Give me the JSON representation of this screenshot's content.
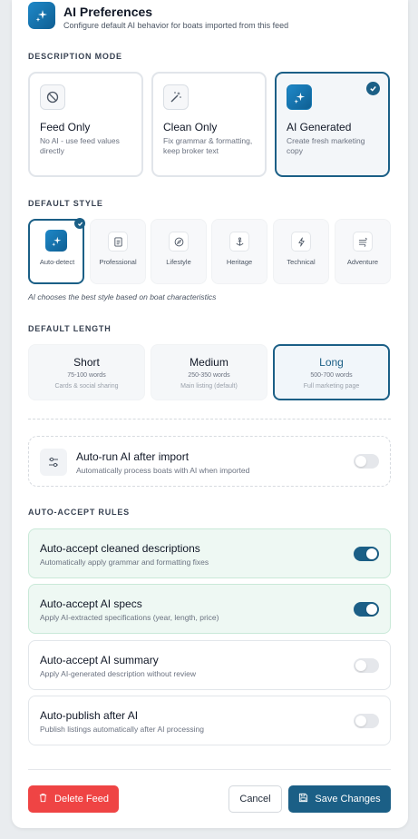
{
  "header": {
    "title": "AI Preferences",
    "subtitle": "Configure default AI behavior for boats imported from this feed",
    "icon": "sparkles-icon"
  },
  "description_mode": {
    "label": "DESCRIPTION MODE",
    "options": [
      {
        "title": "Feed Only",
        "desc": "No AI - use feed values directly",
        "icon": "ban-icon",
        "selected": false
      },
      {
        "title": "Clean Only",
        "desc": "Fix grammar & formatting, keep broker text",
        "icon": "magic-wand-icon",
        "selected": false
      },
      {
        "title": "AI Generated",
        "desc": "Create fresh marketing copy",
        "icon": "sparkles-icon",
        "selected": true
      }
    ]
  },
  "default_style": {
    "label": "DEFAULT STYLE",
    "options": [
      {
        "name": "Auto-detect",
        "icon": "sparkles-icon",
        "selected": true
      },
      {
        "name": "Professional",
        "icon": "document-icon",
        "selected": false
      },
      {
        "name": "Lifestyle",
        "icon": "compass-icon",
        "selected": false
      },
      {
        "name": "Heritage",
        "icon": "anchor-icon",
        "selected": false
      },
      {
        "name": "Technical",
        "icon": "lightning-icon",
        "selected": false
      },
      {
        "name": "Adventure",
        "icon": "wind-icon",
        "selected": false
      }
    ],
    "hint": "AI chooses the best style based on boat characteristics"
  },
  "default_length": {
    "label": "DEFAULT LENGTH",
    "options": [
      {
        "title": "Short",
        "words": "75-100 words",
        "desc": "Cards & social sharing",
        "selected": false
      },
      {
        "title": "Medium",
        "words": "250-350 words",
        "desc": "Main listing (default)",
        "selected": false
      },
      {
        "title": "Long",
        "words": "500-700 words",
        "desc": "Full marketing page",
        "selected": true
      }
    ]
  },
  "auto_run": {
    "title": "Auto-run AI after import",
    "desc": "Automatically process boats with AI when imported",
    "icon": "sliders-icon",
    "enabled": false
  },
  "auto_accept": {
    "label": "AUTO-ACCEPT RULES",
    "rules": [
      {
        "title": "Auto-accept cleaned descriptions",
        "desc": "Automatically apply grammar and formatting fixes",
        "enabled": true
      },
      {
        "title": "Auto-accept AI specs",
        "desc": "Apply AI-extracted specifications (year, length, price)",
        "enabled": true
      },
      {
        "title": "Auto-accept AI summary",
        "desc": "Apply AI-generated description without review",
        "enabled": false
      },
      {
        "title": "Auto-publish after AI",
        "desc": "Publish listings automatically after AI processing",
        "enabled": false
      }
    ]
  },
  "footer": {
    "delete_label": "Delete Feed",
    "cancel_label": "Cancel",
    "save_label": "Save Changes"
  },
  "colors": {
    "accent": "#1b5f86",
    "danger": "#ef4444",
    "success_bg": "#eef8f3"
  }
}
